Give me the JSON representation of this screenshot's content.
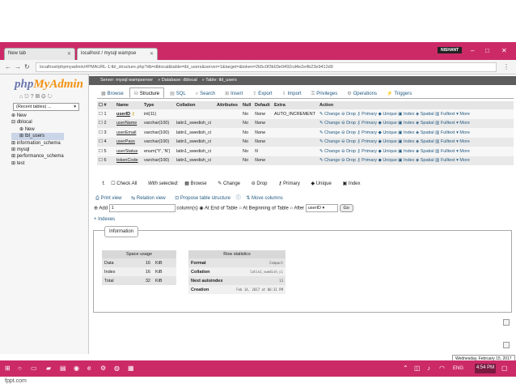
{
  "browser": {
    "tabs": [
      {
        "label": "New tab"
      },
      {
        "label": "localhost / mysql wampse"
      }
    ],
    "user_badge": "NISHANT",
    "address": "localhost/phpmyadmin/#PMAURL-1:tbl_structure.php?db=dblocal&table=tbl_users&server=1&target=&token=2b5c0f3b03e0492cd4e2e4b23e9412d9"
  },
  "sidebar": {
    "logo_php": "php",
    "logo_my": "MyAdmin",
    "filter_select": "(Recent tables) ...",
    "tree": [
      {
        "label": "New",
        "indent": 0
      },
      {
        "label": "dblocal",
        "indent": 0
      },
      {
        "label": "New",
        "indent": 1
      },
      {
        "label": "tbl_users",
        "indent": 1,
        "selected": true
      },
      {
        "label": "information_schema",
        "indent": 0
      },
      {
        "label": "mysql",
        "indent": 0
      },
      {
        "label": "performance_schema",
        "indent": 0
      },
      {
        "label": "test",
        "indent": 0
      }
    ]
  },
  "breadcrumb": {
    "server": "Server: mysql wampserver",
    "database": "Database: dblocal",
    "table": "Table: tbl_users"
  },
  "tabs": [
    {
      "label": "Browse",
      "icon": "▦"
    },
    {
      "label": "Structure",
      "icon": "⛁",
      "active": true
    },
    {
      "label": "SQL",
      "icon": "▤"
    },
    {
      "label": "Search",
      "icon": "⌕"
    },
    {
      "label": "Insert",
      "icon": "⊞"
    },
    {
      "label": "Export",
      "icon": "⇪"
    },
    {
      "label": "Import",
      "icon": "⇩"
    },
    {
      "label": "Privileges",
      "icon": "⚿"
    },
    {
      "label": "Operations",
      "icon": "⚙"
    },
    {
      "label": "Triggers",
      "icon": "⚡"
    }
  ],
  "structure": {
    "headers": [
      "#",
      "Name",
      "Type",
      "Collation",
      "Attributes",
      "Null",
      "Default",
      "Extra",
      "Action"
    ],
    "rows": [
      {
        "num": "1",
        "name": "userID",
        "type": "int(11)",
        "collation": "",
        "attributes": "",
        "null": "No",
        "default": "None",
        "extra": "AUTO_INCREMENT",
        "key": true
      },
      {
        "num": "2",
        "name": "userName",
        "type": "varchar(100)",
        "collation": "latin1_swedish_ci",
        "attributes": "",
        "null": "No",
        "default": "None",
        "extra": ""
      },
      {
        "num": "3",
        "name": "userEmail",
        "type": "varchar(100)",
        "collation": "latin1_swedish_ci",
        "attributes": "",
        "null": "No",
        "default": "None",
        "extra": ""
      },
      {
        "num": "4",
        "name": "userPass",
        "type": "varchar(100)",
        "collation": "latin1_swedish_ci",
        "attributes": "",
        "null": "No",
        "default": "None",
        "extra": ""
      },
      {
        "num": "5",
        "name": "userStatus",
        "type": "enum('Y', 'N')",
        "collation": "latin1_swedish_ci",
        "attributes": "",
        "null": "No",
        "default": "N",
        "extra": ""
      },
      {
        "num": "6",
        "name": "tokenCode",
        "type": "varchar(100)",
        "collation": "latin1_swedish_ci",
        "attributes": "",
        "null": "No",
        "default": "None",
        "extra": ""
      }
    ],
    "actions": [
      "Change",
      "Drop",
      "Primary",
      "Unique",
      "Index",
      "Spatial",
      "Fulltext",
      "More"
    ]
  },
  "with_selected": {
    "check_all": "Check All",
    "label": "With selected:",
    "actions": [
      "Browse",
      "Change",
      "Drop",
      "Primary",
      "Unique",
      "Index"
    ]
  },
  "links": {
    "print": "Print view",
    "relation": "Relation view",
    "propose": "Propose table structure",
    "move": "Move columns"
  },
  "add_row": {
    "label": "Add",
    "value": "1",
    "columns_label": "column(s)",
    "end": "At End of Table",
    "beginning": "At Beginning of Table",
    "after": "After",
    "after_select": "userID",
    "go": "Go"
  },
  "indexes": "+ Indexes",
  "information": {
    "legend": "Information",
    "space_usage": {
      "title": "Space usage",
      "rows": [
        {
          "label": "Data",
          "value": "16",
          "unit": "KiB"
        },
        {
          "label": "Index",
          "value": "16",
          "unit": "KiB"
        },
        {
          "label": "Total",
          "value": "32",
          "unit": "KiB"
        }
      ]
    },
    "row_stats": {
      "title": "Row statistics",
      "rows": [
        {
          "label": "Format",
          "value": "Compact"
        },
        {
          "label": "Collation",
          "value": "latin1_swedish_ci"
        },
        {
          "label": "Next autoindex",
          "value": "13"
        },
        {
          "label": "Creation",
          "value": "Feb 14, 2017 at 06:31 PM"
        }
      ]
    }
  },
  "date_tooltip": "Wednesday, February 15, 2017",
  "taskbar": {
    "time": "4:54 PM",
    "lang": "ENG"
  },
  "footer": "fppt.com"
}
